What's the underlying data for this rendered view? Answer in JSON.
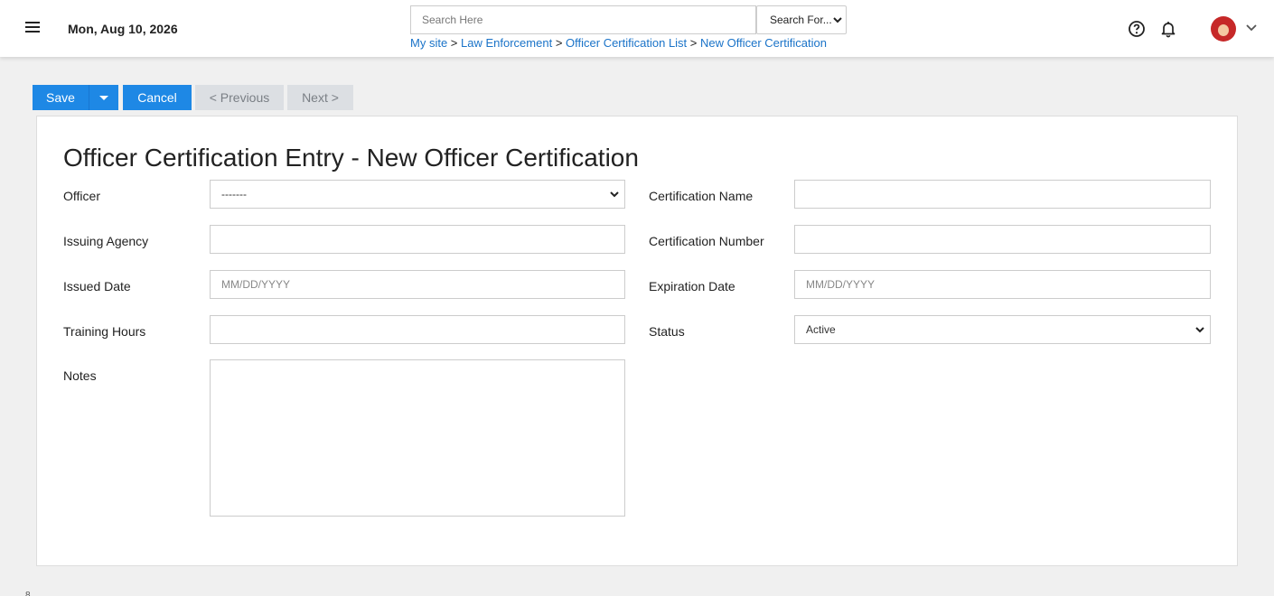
{
  "header": {
    "date": "Mon, Aug 10, 2026",
    "search_placeholder": "Search Here",
    "search_type": "Search For...",
    "breadcrumb": [
      "My site",
      "Law Enforcement",
      "Officer Certification List",
      "New Officer Certification"
    ],
    "breadcrumb_separator": ">"
  },
  "toolbar": {
    "save": "Save",
    "cancel": "Cancel",
    "previous": "< Previous",
    "next": "Next >"
  },
  "form": {
    "title": "Officer Certification Entry - New Officer Certification",
    "officer_label": "Officer",
    "officer_value": "-------",
    "certification_name_label": "Certification Name",
    "certification_name_value": "",
    "issuing_agency_label": "Issuing Agency",
    "issuing_agency_value": "",
    "certification_number_label": "Certification Number",
    "certification_number_value": "",
    "issued_date_label": "Issued Date",
    "issued_date_placeholder": "MM/DD/YYYY",
    "expiration_date_label": "Expiration Date",
    "expiration_date_placeholder": "MM/DD/YYYY",
    "training_hours_label": "Training Hours",
    "training_hours_value": "",
    "status_label": "Status",
    "status_value": "Active",
    "notes_label": "Notes",
    "notes_value": ""
  },
  "icons": {
    "menu": "menu-icon",
    "help": "help-circle-icon",
    "notifications": "bell-icon",
    "avatar": "avatar",
    "dropdown": "chevron-down-icon"
  },
  "colors": {
    "primary": "#1e88e5",
    "link": "#1a73c8",
    "disabled_button": "#dcdfe3",
    "page_background": "#f0f0f0"
  },
  "footer_fragment": "8"
}
